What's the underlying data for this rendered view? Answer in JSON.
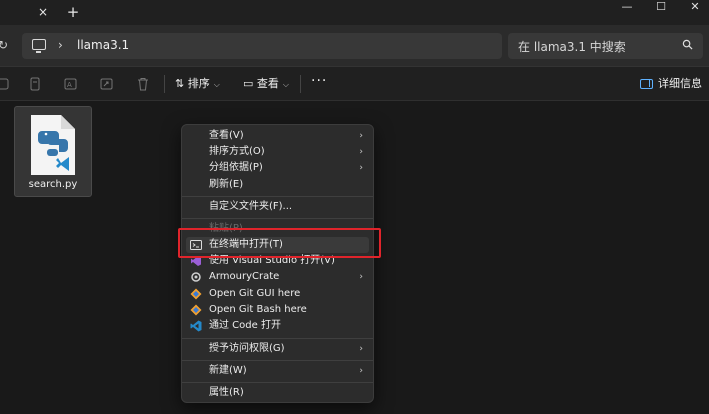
{
  "tab": {
    "close_glyph": "×",
    "new_glyph": "+"
  },
  "window": {
    "min_glyph": "—",
    "max_glyph": "☐",
    "close_glyph": "✕"
  },
  "address": {
    "separator": "›",
    "folder": "llama3.1"
  },
  "search": {
    "placeholder": "在 llama3.1 中搜索"
  },
  "commandbar": {
    "sort_label": "排序",
    "view_label": "查看",
    "more_label": "···",
    "details_label": "详细信息"
  },
  "file": {
    "name": "search.py"
  },
  "context_menu": {
    "items": [
      {
        "label": "查看(V)"
      },
      {
        "label": "排序方式(O)"
      },
      {
        "label": "分组依据(P)"
      },
      {
        "label": "刷新(E)"
      },
      {
        "label": "自定义文件夹(F)..."
      },
      {
        "label": "粘贴(P)"
      },
      {
        "label": "在终端中打开(T)"
      },
      {
        "label": "使用 Visual Studio 打开(V)"
      },
      {
        "label": "ArmouryCrate"
      },
      {
        "label": "Open Git GUI here"
      },
      {
        "label": "Open Git Bash here"
      },
      {
        "label": "通过 Code 打开"
      },
      {
        "label": "授予访问权限(G)"
      },
      {
        "label": "新建(W)"
      },
      {
        "label": "属性(R)"
      }
    ],
    "submenu_arrow": "›"
  },
  "colors": {
    "highlight_box": "#e0242b",
    "accent": "#5fb2ff"
  }
}
